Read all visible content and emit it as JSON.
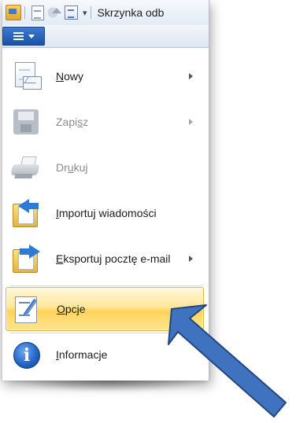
{
  "window": {
    "title": "Skrzynka odb"
  },
  "qat": {
    "more_glyph": "▾"
  },
  "menu": {
    "items": [
      {
        "id": "new",
        "label_pre": "",
        "label_key": "N",
        "label_post": "owy",
        "has_submenu": true,
        "enabled": true,
        "icon": "new-message-icon"
      },
      {
        "id": "save",
        "label_pre": "Zapi",
        "label_key": "s",
        "label_post": "z",
        "has_submenu": true,
        "enabled": false,
        "icon": "save-icon"
      },
      {
        "id": "print",
        "label_pre": "Dr",
        "label_key": "u",
        "label_post": "kuj",
        "has_submenu": false,
        "enabled": false,
        "icon": "printer-icon"
      },
      {
        "id": "import",
        "label_pre": "",
        "label_key": "I",
        "label_post": "mportuj wiadomości",
        "has_submenu": false,
        "enabled": true,
        "icon": "import-folder-icon"
      },
      {
        "id": "export",
        "label_pre": "",
        "label_key": "E",
        "label_post": "ksportuj pocztę e-mail",
        "has_submenu": true,
        "enabled": true,
        "icon": "export-folder-icon"
      },
      {
        "id": "options",
        "label_pre": "",
        "label_key": "O",
        "label_post": "pcje",
        "has_submenu": true,
        "enabled": true,
        "highlighted": true,
        "icon": "options-icon"
      },
      {
        "id": "about",
        "label_pre": "",
        "label_key": "I",
        "label_post": "nformacje",
        "has_submenu": false,
        "enabled": true,
        "icon": "info-icon"
      }
    ]
  },
  "colors": {
    "highlight": "#ffd35a",
    "pointer_arrow": "#3f73c0",
    "menu_button": "#1b52a8"
  }
}
